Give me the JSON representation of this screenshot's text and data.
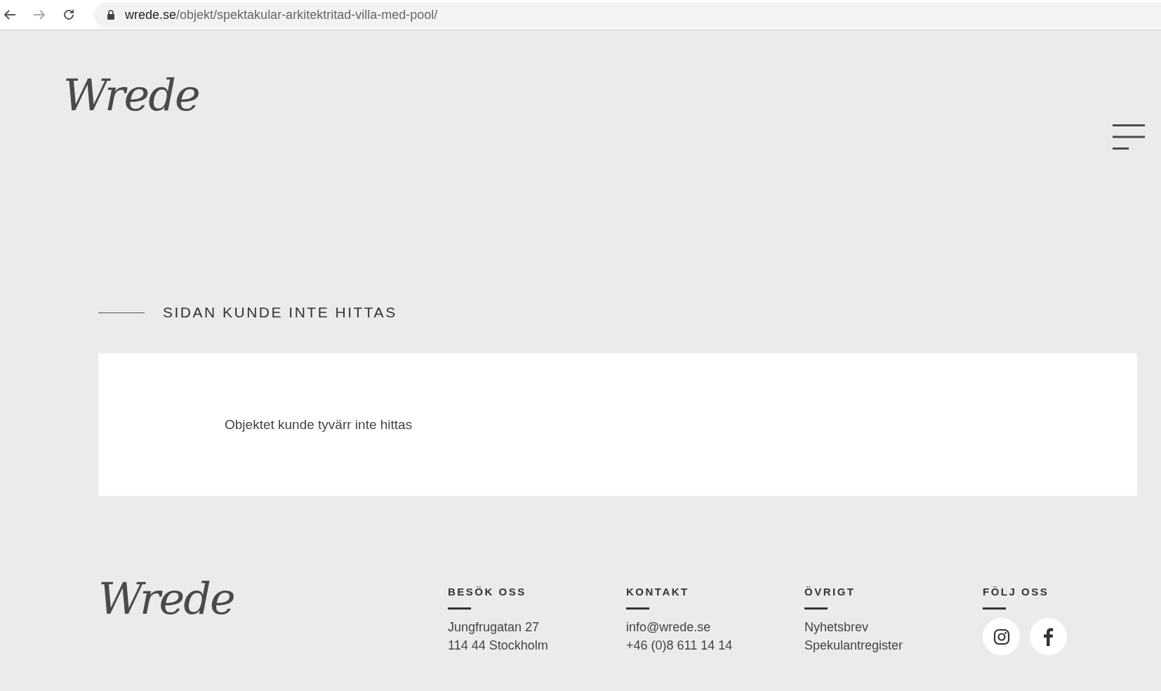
{
  "browser": {
    "url_host": "wrede.se",
    "url_path": "/objekt/spektakular-arkitektritad-villa-med-pool/"
  },
  "header": {
    "logo": "Wrede"
  },
  "page": {
    "heading": "SIDAN KUNDE INTE HITTAS",
    "message": "Objektet kunde tyvärr inte hittas"
  },
  "footer": {
    "logo": "Wrede",
    "columns": [
      {
        "title": "BESÖK OSS",
        "lines": [
          "Jungfrugatan 27",
          "114 44 Stockholm"
        ]
      },
      {
        "title": "KONTAKT",
        "lines": [
          "info@wrede.se",
          "+46 (0)8 611 14 14"
        ]
      },
      {
        "title": "ÖVRIGT",
        "lines": [
          "Nyhetsbrev",
          "Spekulantregister"
        ]
      },
      {
        "title": "FÖLJ OSS",
        "social": [
          {
            "kind": "instagram"
          },
          {
            "kind": "facebook"
          }
        ]
      }
    ]
  }
}
